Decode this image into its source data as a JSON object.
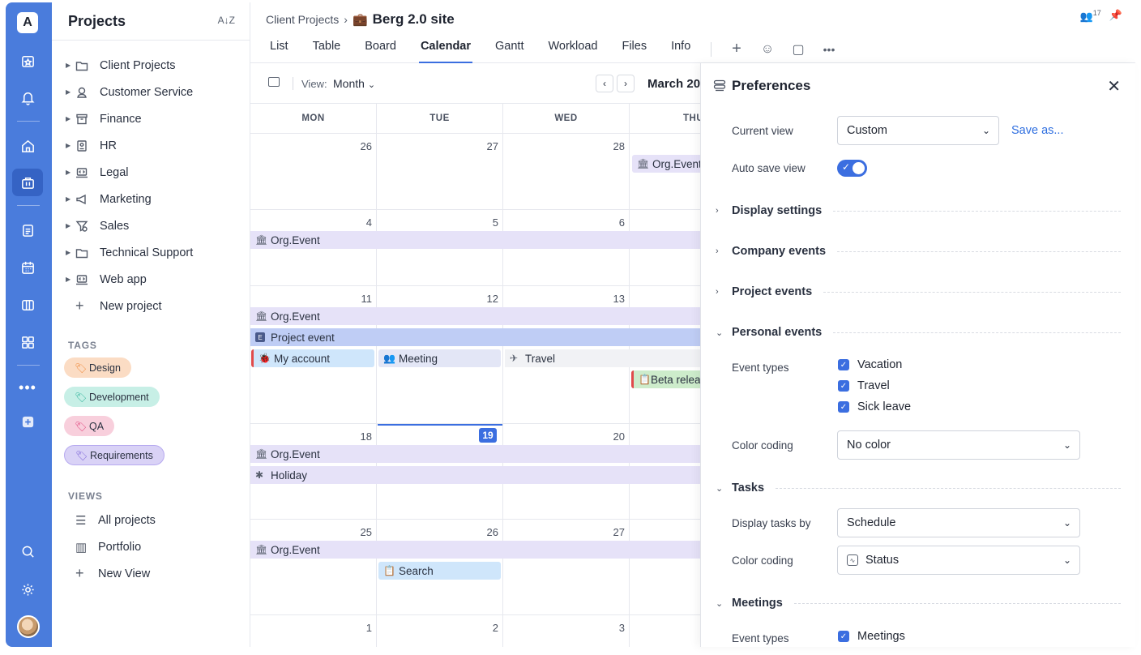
{
  "app": {
    "logo_letter": "A"
  },
  "sidebar": {
    "title": "Projects",
    "sort_icon": "sort-az-icon",
    "projects": [
      {
        "label": "Client Projects",
        "icon": "folder-icon"
      },
      {
        "label": "Customer Service",
        "icon": "headset-icon"
      },
      {
        "label": "Finance",
        "icon": "archive-box-icon"
      },
      {
        "label": "HR",
        "icon": "id-card-icon"
      },
      {
        "label": "Legal",
        "icon": "laptop-code-icon"
      },
      {
        "label": "Marketing",
        "icon": "megaphone-icon"
      },
      {
        "label": "Sales",
        "icon": "funnel-icon"
      },
      {
        "label": "Technical Support",
        "icon": "folder-icon"
      },
      {
        "label": "Web app",
        "icon": "laptop-code-icon"
      }
    ],
    "new_project": "New project",
    "tags_label": "TAGS",
    "tags": [
      {
        "label": "Design",
        "bg": "#fbdcc4",
        "icon_color": "#f08a3c"
      },
      {
        "label": "Development",
        "bg": "#c7efe6",
        "icon_color": "#2eb39a"
      },
      {
        "label": "QA",
        "bg": "#f8cfdc",
        "icon_color": "#e0407a"
      },
      {
        "label": "Requirements",
        "bg": "#d9d2f6",
        "icon_color": "#7a62d8"
      }
    ],
    "views_label": "VIEWS",
    "views": [
      {
        "label": "All projects",
        "icon": "list-icon"
      },
      {
        "label": "Portfolio",
        "icon": "books-icon"
      },
      {
        "label": "New View",
        "icon": "plus-icon"
      }
    ]
  },
  "header": {
    "breadcrumb_parent": "Client Projects",
    "breadcrumb_current": "Berg 2.0 site",
    "tabs": [
      "List",
      "Table",
      "Board",
      "Calendar",
      "Gantt",
      "Workload",
      "Files",
      "Info"
    ],
    "active_tab": "Calendar",
    "members_count": "17"
  },
  "calendar": {
    "view_label": "View:",
    "view_value": "Month",
    "month_label": "March 20",
    "days_of_week": [
      "MON",
      "TUE",
      "WED",
      "THU"
    ],
    "weeks": [
      [
        "26",
        "27",
        "28",
        ""
      ],
      [
        "4",
        "5",
        "6",
        ""
      ],
      [
        "11",
        "12",
        "13",
        ""
      ],
      [
        "18",
        "19",
        "20",
        ""
      ],
      [
        "25",
        "26",
        "27",
        ""
      ],
      [
        "1",
        "2",
        "3",
        ""
      ]
    ],
    "today": "19",
    "events": {
      "w1_org": "Org.Event",
      "w2_org": "Org.Event",
      "w3_org": "Org.Event",
      "w3_project": "Project event",
      "w3_project_badge": "E",
      "w3_account": "My account",
      "w3_meeting": "Meeting",
      "w3_travel": "Travel",
      "w3_beta": "Beta relea",
      "w4_org": "Org.Event",
      "w4_holiday": "Holiday",
      "w5_org": "Org.Event",
      "w5_search": "Search"
    }
  },
  "preferences": {
    "title": "Preferences",
    "current_view_label": "Current view",
    "current_view_value": "Custom",
    "save_as": "Save as...",
    "auto_save_label": "Auto save view",
    "auto_save_on": true,
    "sections": {
      "display": "Display settings",
      "company": "Company events",
      "project": "Project events",
      "personal": "Personal events",
      "tasks": "Tasks",
      "meetings": "Meetings"
    },
    "personal": {
      "event_types_label": "Event types",
      "types": [
        "Vacation",
        "Travel",
        "Sick leave"
      ],
      "color_coding_label": "Color coding",
      "color_coding_value": "No color"
    },
    "tasks": {
      "display_by_label": "Display tasks by",
      "display_by_value": "Schedule",
      "color_coding_label": "Color coding",
      "color_coding_value": "Status"
    },
    "meetings": {
      "event_types_label": "Event types",
      "types": [
        "Meetings"
      ]
    }
  },
  "colors": {
    "accent": "#3b6ee0",
    "rail": "#4a7cdc"
  }
}
